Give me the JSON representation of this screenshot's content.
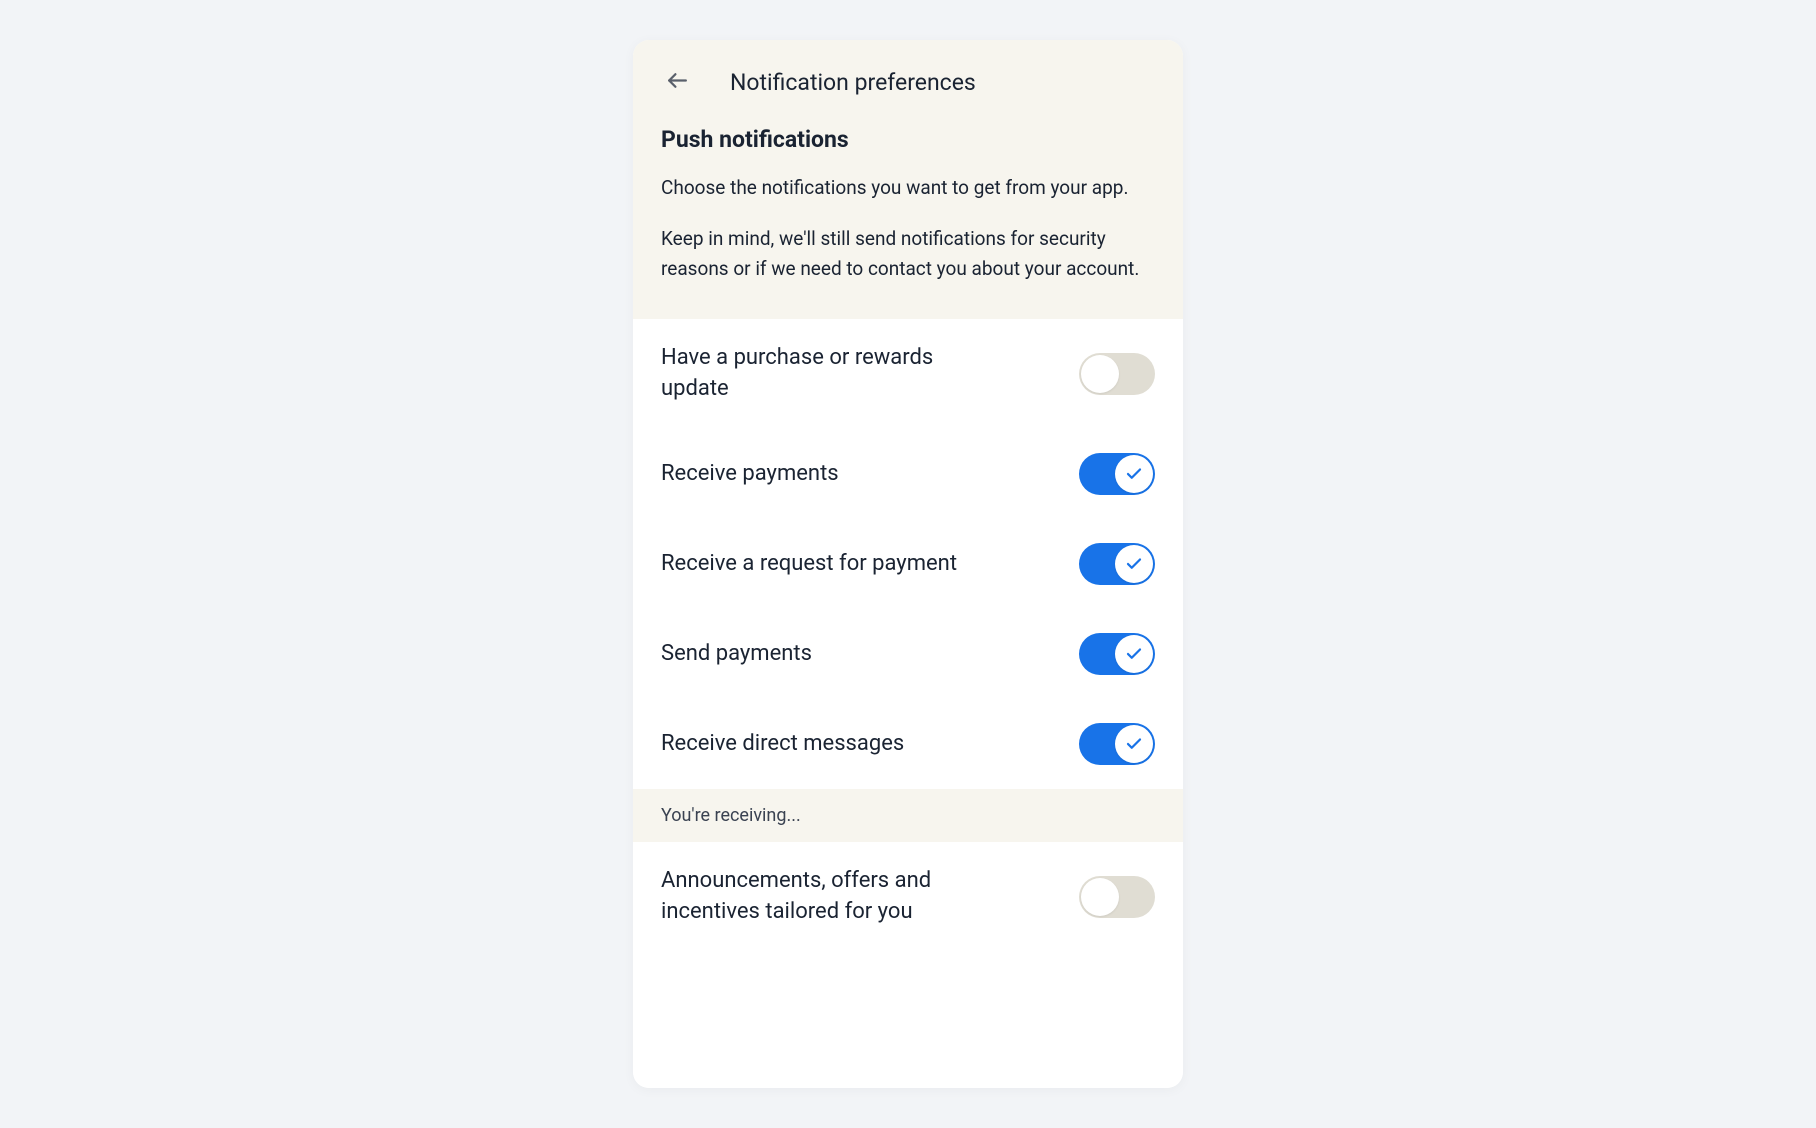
{
  "header": {
    "title": "Notification preferences"
  },
  "section": {
    "title": "Push notifications",
    "description1": "Choose the notifications you want to get from your app.",
    "description2": "Keep in mind, we'll still send notifications for security reasons or if we need to contact you about your account."
  },
  "toggles": [
    {
      "label": "Have a purchase or rewards update",
      "enabled": false
    },
    {
      "label": "Receive payments",
      "enabled": true
    },
    {
      "label": "Receive a request for payment",
      "enabled": true
    },
    {
      "label": "Send payments",
      "enabled": true
    },
    {
      "label": "Receive direct messages",
      "enabled": true
    }
  ],
  "subheader": "You're receiving...",
  "toggles2": [
    {
      "label": "Announcements, offers and incentives tailored for you",
      "enabled": false
    }
  ],
  "colors": {
    "accent": "#1873e8",
    "text_primary": "#1a2332",
    "panel_bg": "#f7f5ee",
    "toggle_off": "#e0ddd3"
  }
}
